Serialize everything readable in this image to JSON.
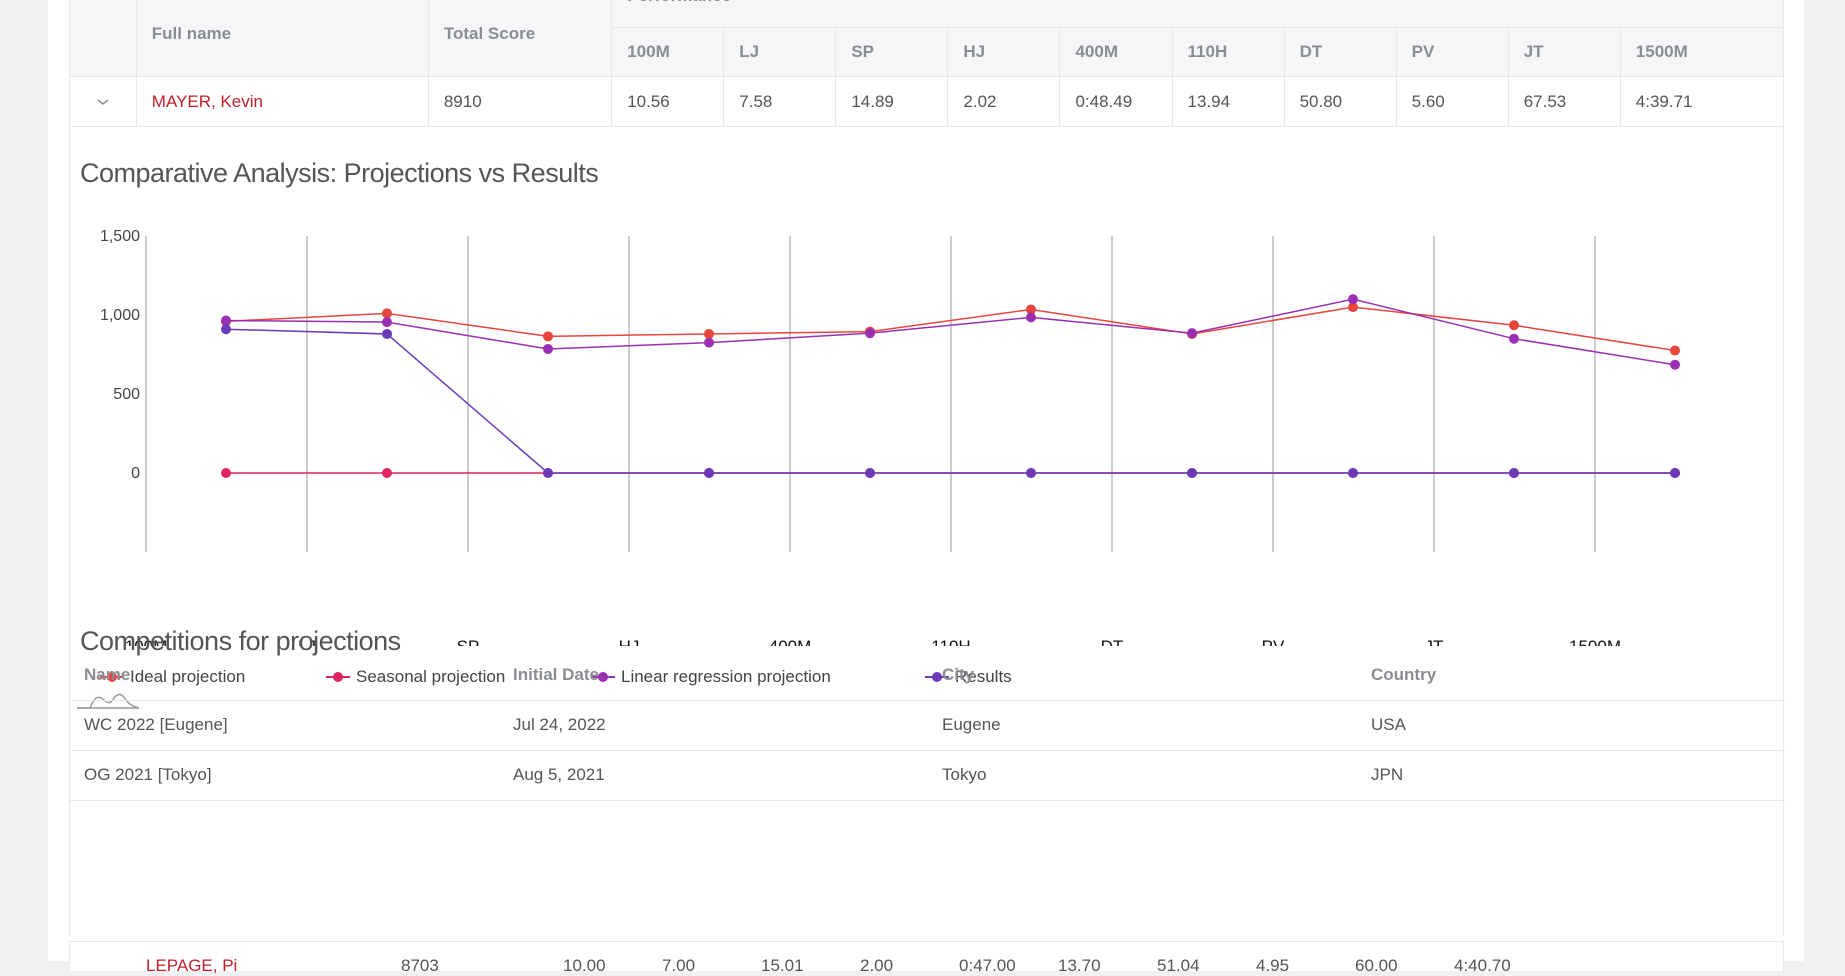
{
  "athlete_table": {
    "headers": {
      "full_name": "Full name",
      "total_score": "Total Score",
      "performance": "Performance",
      "events": [
        "100M",
        "LJ",
        "SP",
        "HJ",
        "400M",
        "110H",
        "DT",
        "PV",
        "JT",
        "1500M"
      ]
    },
    "row": {
      "name": "MAYER, Kevin",
      "total_score": "8910",
      "results": [
        "10.56",
        "7.58",
        "14.89",
        "2.02",
        "0:48.49",
        "13.94",
        "50.80",
        "5.60",
        "67.53",
        "4:39.71"
      ]
    }
  },
  "chart_section": {
    "title": "Comparative Analysis: Projections vs Results"
  },
  "chart_data": {
    "type": "line",
    "categories": [
      "100M",
      "LJ",
      "SP",
      "HJ",
      "400M",
      "110H",
      "DT",
      "PV",
      "JT",
      "1500M"
    ],
    "ylim": [
      -500,
      1500
    ],
    "yticks": [
      "1,500",
      "1,000",
      "500",
      "0"
    ],
    "series": [
      {
        "name": "Ideal projection",
        "color": "#e8453c",
        "values": [
          960,
          1010,
          865,
          880,
          895,
          1035,
          880,
          1050,
          935,
          775
        ]
      },
      {
        "name": "Seasonal projection",
        "color": "#e0245e",
        "values": [
          0,
          0,
          0,
          0,
          0,
          0,
          0,
          0,
          0,
          0
        ]
      },
      {
        "name": "Linear regression projection",
        "color": "#9b2fb3",
        "values": [
          965,
          955,
          785,
          825,
          885,
          985,
          885,
          1100,
          850,
          685
        ]
      },
      {
        "name": "Results",
        "color": "#6a3ab8",
        "values": [
          910,
          880,
          0,
          0,
          0,
          0,
          0,
          0,
          0,
          0
        ]
      }
    ]
  },
  "competitions": {
    "title": "Competitions for projections",
    "headers": [
      "Name",
      "Initial Date",
      "City",
      "Country"
    ],
    "rows": [
      [
        "WC 2022 [Eugene]",
        "Jul 24, 2022",
        "Eugene",
        "USA"
      ],
      [
        "OG 2021 [Tokyo]",
        "Aug 5, 2021",
        "Tokyo",
        "JPN"
      ]
    ]
  },
  "next_row_partial": {
    "name": "LEPAGE, Pi",
    "total_score": "8703",
    "results": [
      "10.00",
      "7.00",
      "15.01",
      "2.00",
      "0:47.00",
      "13.70",
      "51.04",
      "4.95",
      "60.00",
      "4:40.70"
    ]
  }
}
